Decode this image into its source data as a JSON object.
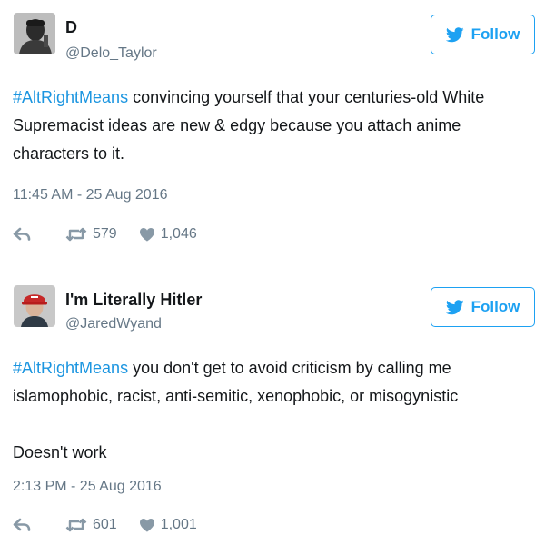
{
  "tweets": [
    {
      "display_name": "D",
      "handle": "@Delo_Taylor",
      "follow_label": "Follow",
      "hashtag": "#AltRightMeans",
      "text": " convincing yourself that your centuries-old White Supremacist ideas are new & edgy because you attach anime characters to it.",
      "extra_text": "",
      "timestamp": "11:45 AM - 25 Aug 2016",
      "retweets": "579",
      "likes": "1,046"
    },
    {
      "display_name": "I'm Literally Hitler",
      "handle": "@JaredWyand",
      "follow_label": "Follow",
      "hashtag": "#AltRightMeans",
      "text": " you don't get to avoid criticism by calling me islamophobic, racist, anti-semitic, xenophobic, or misogynistic",
      "extra_text": "Doesn't work",
      "timestamp": "2:13 PM - 25 Aug 2016",
      "retweets": "601",
      "likes": "1,001"
    }
  ],
  "colors": {
    "accent": "#1da1f2",
    "hashtag": "#1b95e0",
    "muted": "#657786",
    "icon": "#8899a6",
    "text": "#14171a"
  },
  "icons": {
    "follow": "twitter-bird-icon",
    "reply": "reply-arrow-icon",
    "retweet": "retweet-icon",
    "like": "heart-icon"
  }
}
